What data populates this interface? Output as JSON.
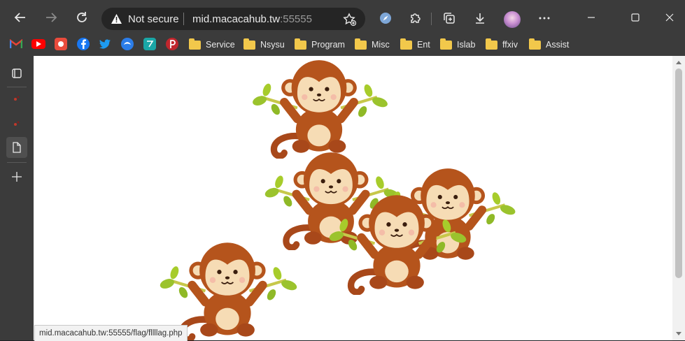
{
  "browser": {
    "address_bar": {
      "security_label": "Not secure",
      "url_host": "mid.macacahub.tw",
      "url_port": ":55555"
    },
    "icons": {
      "back": "back-arrow-icon",
      "forward": "forward-arrow-icon",
      "refresh": "refresh-icon",
      "favorite": "add-favorite-icon",
      "extension1": "compass-icon",
      "extensions": "puzzle-icon",
      "collections": "collections-icon",
      "downloads": "download-icon",
      "profile": "avatar",
      "more": "more-icon"
    }
  },
  "bookmarks": {
    "folders": [
      "Service",
      "Nsysu",
      "Program",
      "Misc",
      "Ent",
      "Islab",
      "ffxiv",
      "Assist"
    ]
  },
  "status": {
    "link_url": "mid.macacahub.tw:55555/flag/fllllag.php"
  },
  "colors": {
    "chrome_bg": "#3b3b3b",
    "folder": "#f2c84b",
    "monkey_fur": "#b5541c",
    "monkey_face": "#f6dcb5"
  }
}
